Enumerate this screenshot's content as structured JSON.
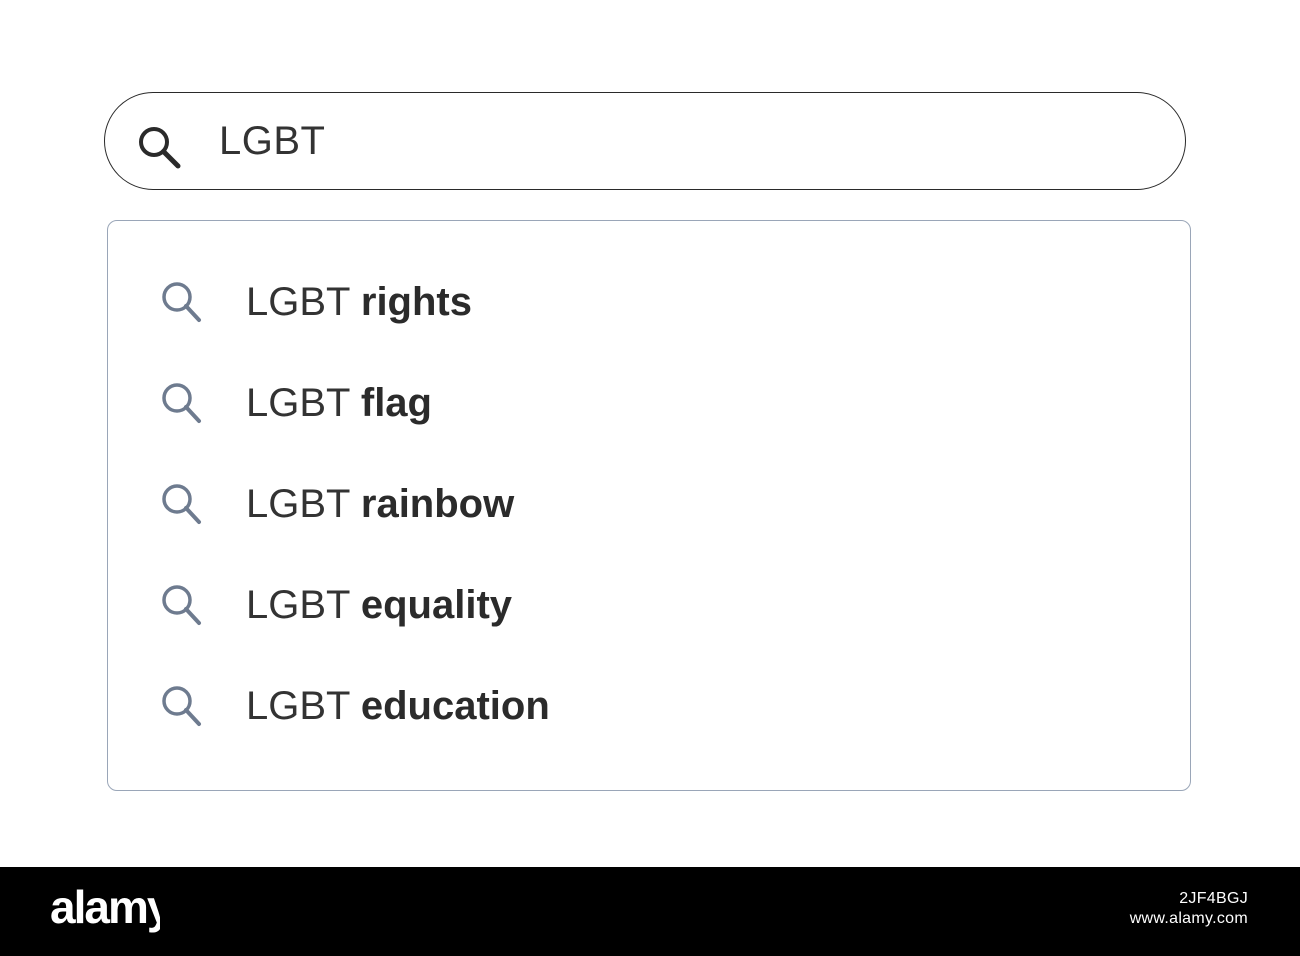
{
  "search": {
    "query": "LGBT",
    "icon": "search-icon"
  },
  "suggestions": [
    {
      "prefix": "LGBT",
      "completion": "rights"
    },
    {
      "prefix": "LGBT",
      "completion": "flag"
    },
    {
      "prefix": "LGBT",
      "completion": "rainbow"
    },
    {
      "prefix": "LGBT",
      "completion": "equality"
    },
    {
      "prefix": "LGBT",
      "completion": "education"
    }
  ],
  "colors": {
    "text": "#333333",
    "suggestion_icon": "#6e7b8f",
    "search_icon": "#2a2a2a",
    "dropdown_border": "#9aa6b8",
    "watermark_bg": "#000000"
  },
  "watermark": {
    "brand": "alamy",
    "image_id": "2JF4BGJ",
    "site": "www.alamy.com"
  }
}
